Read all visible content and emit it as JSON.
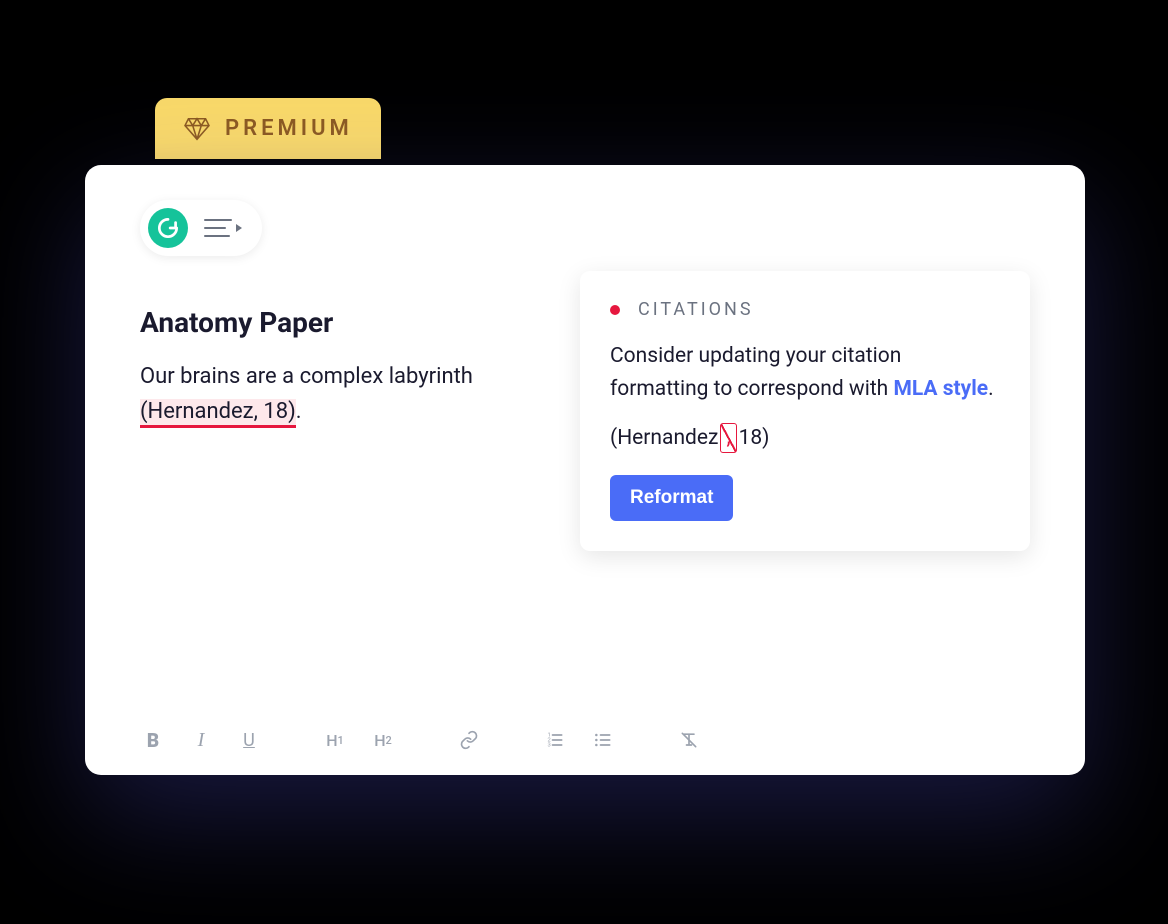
{
  "premium": {
    "label": "PREMIUM"
  },
  "document": {
    "title": "Anatomy Paper",
    "body_prefix": "Our brains are a complex labyrinth ",
    "body_highlighted": "(Hernandez, 18)",
    "body_suffix": "."
  },
  "suggestion": {
    "category": "CITATIONS",
    "message_prefix": "Consider updating your citation formatting to correspond with ",
    "style_name": "MLA style",
    "message_suffix": ".",
    "example_prefix": "(Hernandez",
    "example_correction": ",",
    "example_suffix": "18)",
    "action_label": "Reformat"
  },
  "toolbar": {
    "bold": "B",
    "italic": "I",
    "underline": "U",
    "h1": "H",
    "h1_sub": "1",
    "h2": "H",
    "h2_sub": "2"
  }
}
